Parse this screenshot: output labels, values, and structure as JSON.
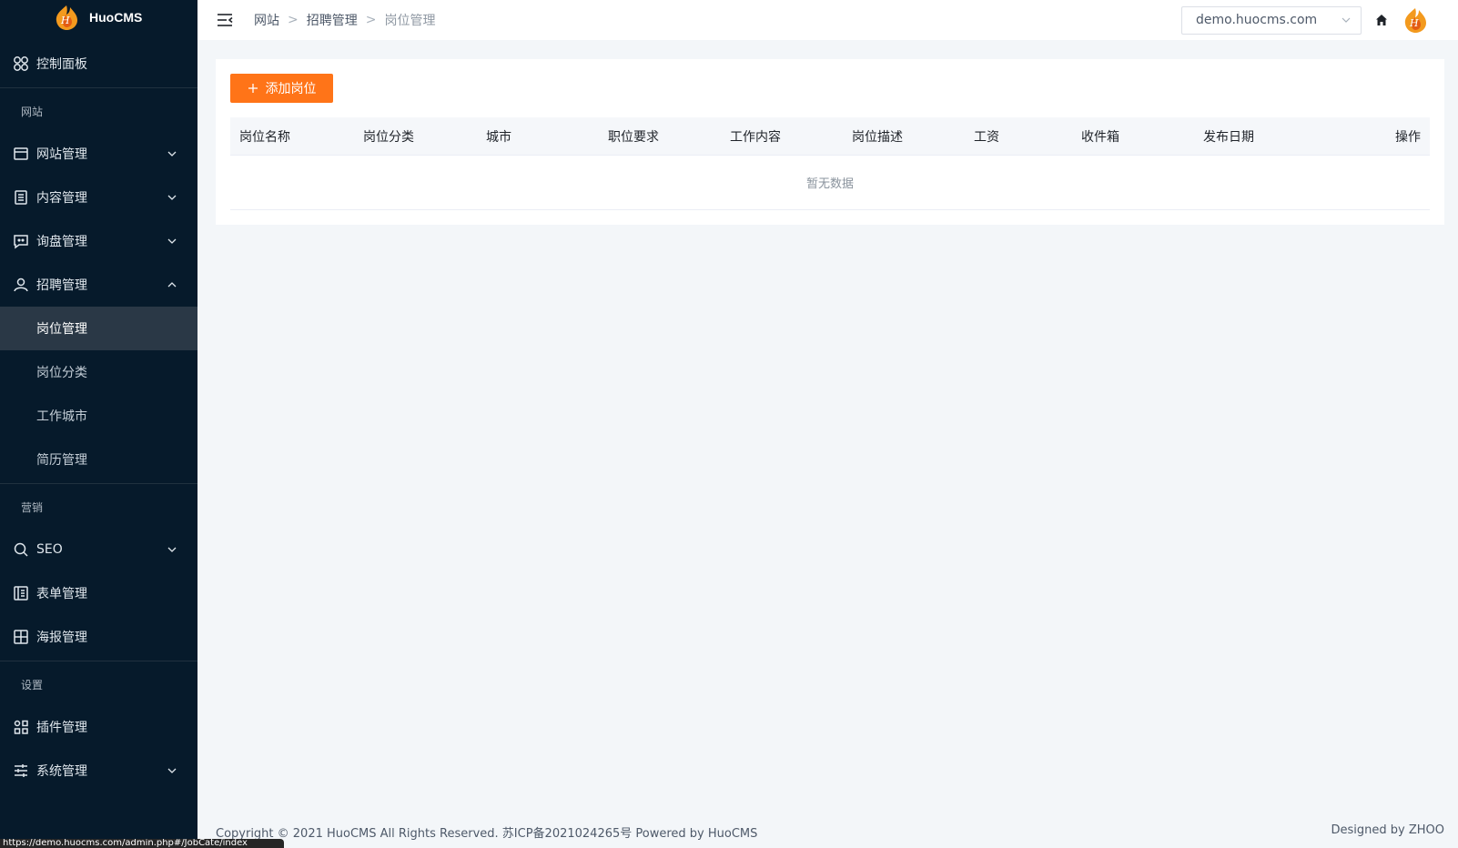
{
  "sidebar": {
    "brand": "HuoCMS",
    "dashboard": "控制面板",
    "groups": {
      "website": "网站",
      "marketing": "营销",
      "settings": "设置"
    },
    "items": {
      "site_mgmt": "网站管理",
      "content_mgmt": "内容管理",
      "inquiry_mgmt": "询盘管理",
      "recruit_mgmt": "招聘管理",
      "seo": "SEO",
      "form_mgmt": "表单管理",
      "poster_mgmt": "海报管理",
      "plugin_mgmt": "插件管理",
      "system_mgmt": "系统管理"
    },
    "recruit_sub": [
      "岗位管理",
      "岗位分类",
      "工作城市",
      "简历管理"
    ]
  },
  "header": {
    "breadcrumb": [
      "网站",
      "招聘管理",
      "岗位管理"
    ],
    "separator": ">",
    "site_select_value": "demo.huocms.com"
  },
  "main": {
    "add_button": "添加岗位",
    "columns": [
      "岗位名称",
      "岗位分类",
      "城市",
      "职位要求",
      "工作内容",
      "岗位描述",
      "工资",
      "收件箱",
      "发布日期",
      "操作"
    ],
    "empty_text": "暂无数据"
  },
  "footer": {
    "copyright": "Copyright © 2021 HuoCMS All Rights Reserved. 苏ICP备2021024265号 Powered by HuoCMS",
    "designed": "Designed by ZHOO"
  },
  "status_url": "https://demo.huocms.com/admin.php#/JobCate/index",
  "colors": {
    "sidebar_bg": "#061a2b",
    "accent": "#ff7418"
  }
}
